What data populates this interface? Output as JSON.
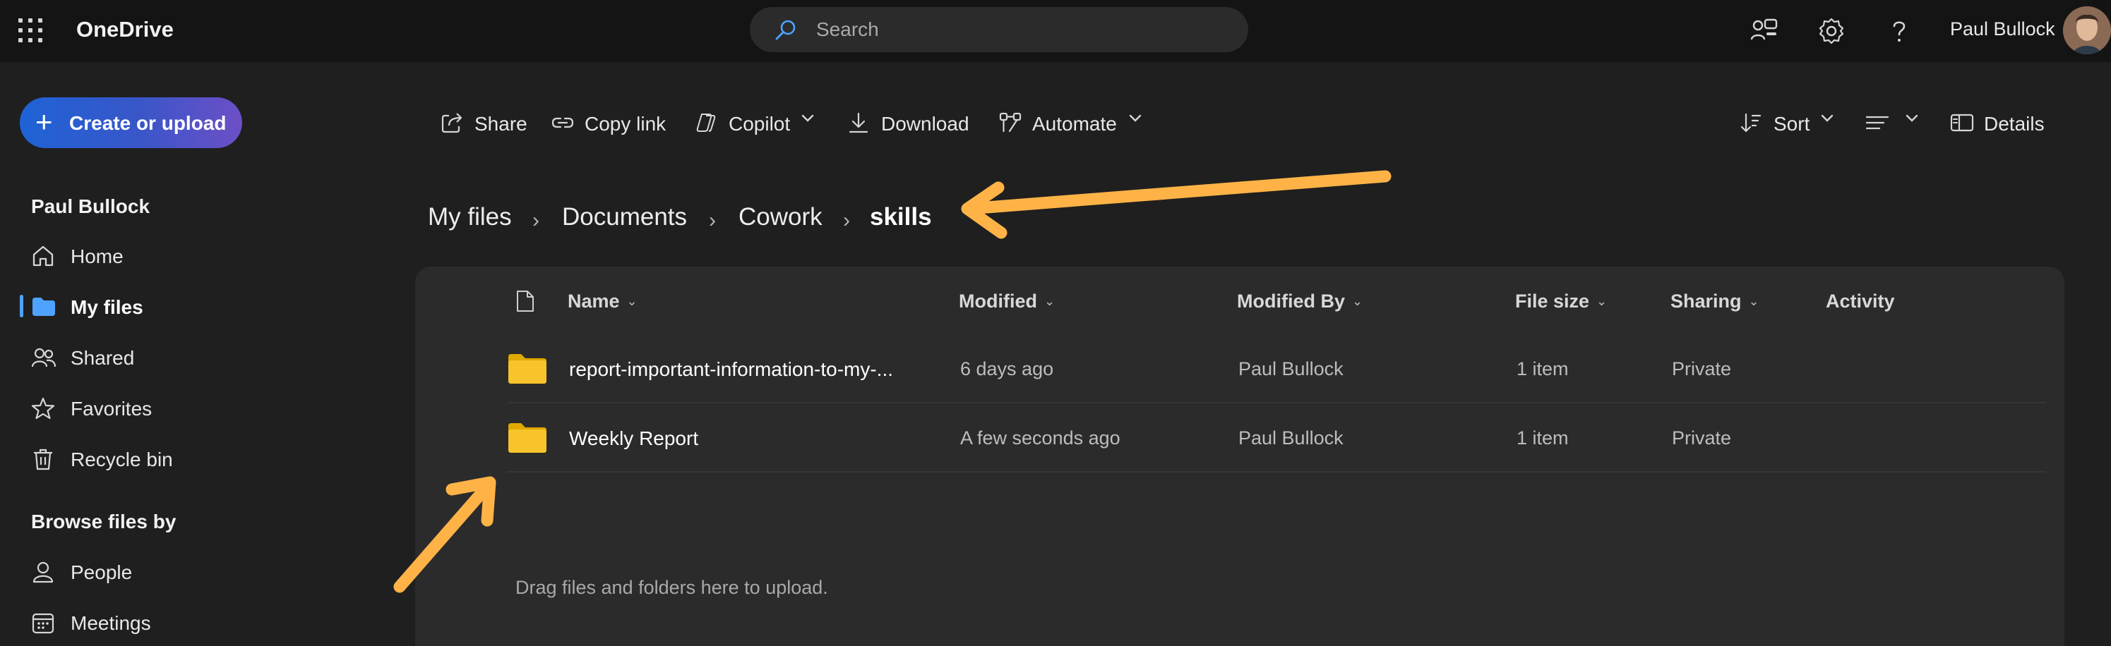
{
  "app": {
    "title": "OneDrive"
  },
  "search": {
    "placeholder": "Search"
  },
  "user": {
    "name": "Paul Bullock"
  },
  "sidebar": {
    "create_label": "Create or upload",
    "section_user": "Paul Bullock",
    "items": [
      {
        "label": "Home",
        "icon": "home-icon"
      },
      {
        "label": "My files",
        "icon": "folder-icon",
        "active": true
      },
      {
        "label": "Shared",
        "icon": "shared-people-icon"
      },
      {
        "label": "Favorites",
        "icon": "star-icon"
      },
      {
        "label": "Recycle bin",
        "icon": "trash-icon"
      }
    ],
    "section_browse": "Browse files by",
    "browse_items": [
      {
        "label": "People",
        "icon": "person-icon"
      },
      {
        "label": "Meetings",
        "icon": "calendar-icon"
      }
    ]
  },
  "commands": {
    "share": "Share",
    "copy_link": "Copy link",
    "copilot": "Copilot",
    "download": "Download",
    "automate": "Automate",
    "sort": "Sort",
    "details": "Details"
  },
  "breadcrumb": [
    "My files",
    "Documents",
    "Cowork",
    "skills"
  ],
  "table": {
    "columns": {
      "name": "Name",
      "modified": "Modified",
      "modified_by": "Modified By",
      "file_size": "File size",
      "sharing": "Sharing",
      "activity": "Activity"
    },
    "rows": [
      {
        "name": "report-important-information-to-my-...",
        "modified": "6 days ago",
        "modified_by": "Paul Bullock",
        "size": "1 item",
        "sharing": "Private"
      },
      {
        "name": "Weekly Report",
        "modified": "A few seconds ago",
        "modified_by": "Paul Bullock",
        "size": "1 item",
        "sharing": "Private"
      }
    ],
    "drop_hint": "Drag files and folders here to upload."
  },
  "colors": {
    "accent": "#4da3ff",
    "annotation": "#ffb347",
    "folder": "#f5c518"
  }
}
